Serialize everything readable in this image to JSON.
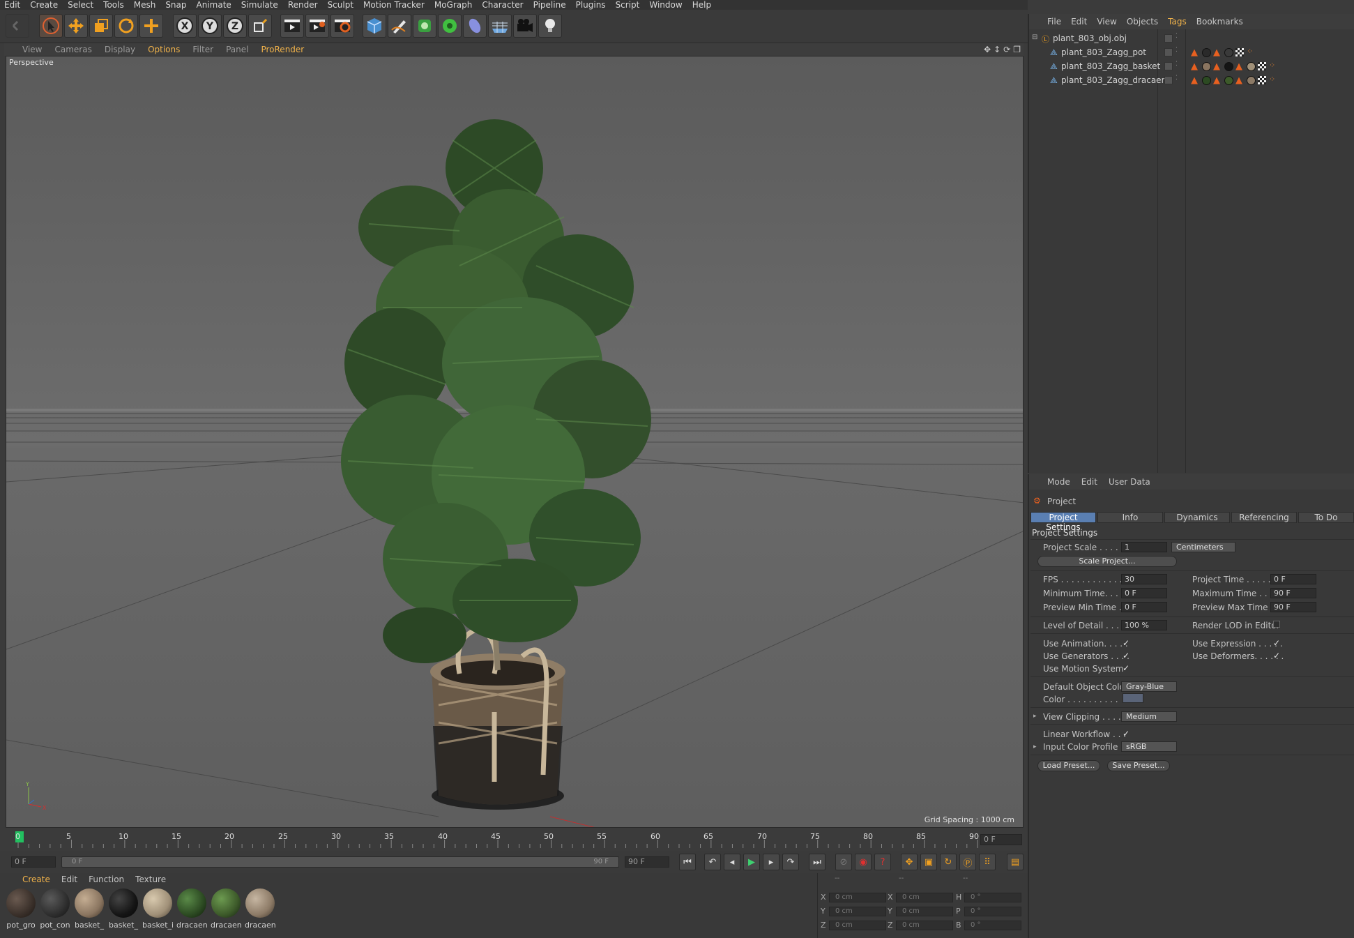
{
  "menubar": [
    "Edit",
    "Create",
    "Select",
    "Tools",
    "Mesh",
    "Snap",
    "Animate",
    "Simulate",
    "Render",
    "Sculpt",
    "Motion Tracker",
    "MoGraph",
    "Character",
    "Pipeline",
    "Plugins",
    "Script",
    "Window",
    "Help"
  ],
  "toolbar": {
    "tools": [
      "undo-icon",
      "live-selection-icon",
      "move-icon",
      "scale-icon",
      "rotate-icon",
      "last-tool-icon",
      "x-axis-icon",
      "y-axis-icon",
      "z-axis-icon",
      "coordinate-system-icon",
      "render-view-icon",
      "render-picture-viewer-icon",
      "render-settings-icon",
      "cube-icon",
      "pen-icon",
      "subdivision-icon",
      "array-icon",
      "deformer-icon",
      "floor-icon",
      "camera-icon",
      "light-icon"
    ]
  },
  "viewport": {
    "menu": [
      "View",
      "Cameras",
      "Display",
      "Options",
      "Filter",
      "Panel",
      "ProRender"
    ],
    "active_menu": "Options",
    "camera_label": "Perspective",
    "grid_spacing": "Grid Spacing : 1000 cm",
    "axes": {
      "x": "X",
      "y": "Y"
    }
  },
  "timeline": {
    "ticks": [
      "0",
      "5",
      "10",
      "15",
      "20",
      "25",
      "30",
      "35",
      "40",
      "45",
      "50",
      "55",
      "60",
      "65",
      "70",
      "75",
      "80",
      "85",
      "90"
    ],
    "current_frame": "0 F",
    "start_field": "0 F",
    "range_start": "0 F",
    "range_end": "90 F",
    "end_field": "90 F"
  },
  "materials": {
    "tabs": [
      "Create",
      "Edit",
      "Function",
      "Texture"
    ],
    "items": [
      {
        "label": "pot_gro",
        "color": "#3a302a"
      },
      {
        "label": "pot_con",
        "color": "#2e2e2e"
      },
      {
        "label": "basket_",
        "color": "#8a7560"
      },
      {
        "label": "basket_",
        "color": "#151515"
      },
      {
        "label": "basket_i",
        "color": "#a09078"
      },
      {
        "label": "dracaen",
        "color": "#2c4a22"
      },
      {
        "label": "dracaen",
        "color": "#3d5a2a"
      },
      {
        "label": "dracaen",
        "color": "#8c7a66"
      }
    ]
  },
  "coordinates": {
    "headers": [
      "--",
      "--",
      "--"
    ],
    "rows": [
      {
        "a": "X",
        "av": "0 cm",
        "b": "X",
        "bv": "0 cm",
        "c": "H",
        "cv": "0 °"
      },
      {
        "a": "Y",
        "av": "0 cm",
        "b": "Y",
        "bv": "0 cm",
        "c": "P",
        "cv": "0 °"
      },
      {
        "a": "Z",
        "av": "0 cm",
        "b": "Z",
        "bv": "0 cm",
        "c": "B",
        "cv": "0 °"
      }
    ]
  },
  "object_manager": {
    "menu": [
      "File",
      "Edit",
      "View",
      "Objects",
      "Tags",
      "Bookmarks"
    ],
    "active_menu": "Tags",
    "objects": [
      {
        "name": "plant_803_obj.obj",
        "depth": 0
      },
      {
        "name": "plant_803_Zagg_pot",
        "depth": 1
      },
      {
        "name": "plant_803_Zagg_basket",
        "depth": 1
      },
      {
        "name": "plant_803_Zagg_dracaena",
        "depth": 1
      }
    ]
  },
  "attributes": {
    "menu": [
      "Mode",
      "Edit",
      "User Data"
    ],
    "object_label": "Project",
    "tabs": [
      "Project Settings",
      "Info",
      "Dynamics",
      "Referencing",
      "To Do"
    ],
    "active_tab": "Project Settings",
    "section": "Project Settings",
    "project_scale_label": "Project Scale . . . . . .",
    "project_scale_value": "1",
    "project_scale_unit": "Centimeters",
    "scale_project_button": "Scale Project...",
    "fps_label": "FPS . . . . . . . . . . . . . .",
    "fps": "30",
    "project_time_label": "Project Time . . . . . . . .",
    "project_time": "0 F",
    "min_time_label": "Minimum Time. . . . .",
    "min_time": "0 F",
    "max_time_label": "Maximum Time . . . . .",
    "max_time": "90 F",
    "preview_min_label": "Preview Min Time . .",
    "preview_min": "0 F",
    "preview_max_label": "Preview Max Time . . .",
    "preview_max": "90 F",
    "lod_label": "Level of Detail . . . . .",
    "lod": "100 %",
    "render_lod_label": "Render LOD in Editor",
    "use_animation_label": "Use Animation. . . . .",
    "use_expression_label": "Use Expression . . . . .",
    "use_generators_label": "Use Generators . . . .",
    "use_deformers_label": "Use Deformers. . . . . .",
    "use_motion_label": "Use Motion System",
    "default_color_label": "Default Object Color",
    "default_color_value": "Gray-Blue",
    "color_label": "Color . . . . . . . . . .",
    "view_clipping_label": "View Clipping . . . . .",
    "view_clipping_value": "Medium",
    "linear_workflow_label": "Linear Workflow . . .",
    "input_color_label": "Input Color Profile . .",
    "input_color_value": "sRGB",
    "load_preset": "Load Preset...",
    "save_preset": "Save Preset...",
    "checkmark": "✓"
  }
}
